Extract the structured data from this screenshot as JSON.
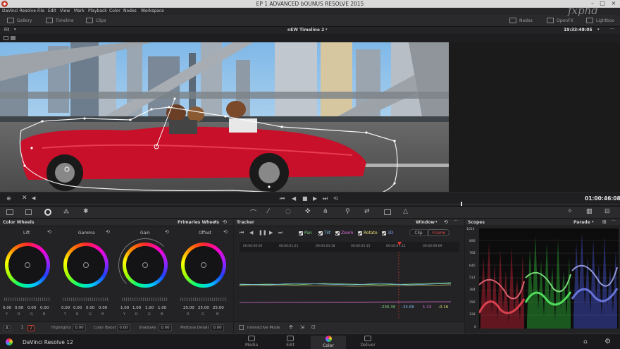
{
  "window": {
    "title": "EP 1 ADVANCED  bOUNUS  RESOLVE 2015",
    "watermark": "fxphd"
  },
  "menu": [
    "DaVinci Resolve",
    "File",
    "Edit",
    "View",
    "Mark",
    "Playback",
    "Color",
    "Nodes",
    "Workspace"
  ],
  "toolbar": {
    "gallery": "Gallery",
    "timeline": "Timeline",
    "clips": "Clips",
    "nodes": "Nodes",
    "openfx": "OpenFX",
    "lightbox": "Lightbox"
  },
  "viewer": {
    "fit": "Fit",
    "timeline_name": "nEW Timeline 2",
    "timecode_top": "19:33:48:05",
    "timecode": "01:00:46:08"
  },
  "color_wheels": {
    "title": "Color Wheels",
    "mode": "Primaries Wheels",
    "wheels": [
      {
        "name": "Lift",
        "values": [
          "0.00",
          "0.00",
          "0.00",
          "0.00"
        ]
      },
      {
        "name": "Gamma",
        "values": [
          "0.00",
          "0.00",
          "0.00",
          "0.00"
        ]
      },
      {
        "name": "Gain",
        "values": [
          "1.00",
          "1.00",
          "1.00",
          "1.00"
        ]
      },
      {
        "name": "Offset",
        "values": [
          "25.00",
          "25.00",
          "25.00",
          ""
        ]
      }
    ],
    "channels": [
      "Y",
      "R",
      "G",
      "B"
    ],
    "page_a": "A",
    "page1": "1",
    "page2": "2",
    "highlights": {
      "label": "Highlights",
      "value": "0.00"
    },
    "color_boost": {
      "label": "Color Boost",
      "value": "0.00"
    },
    "shadows": {
      "label": "Shadows",
      "value": "0.00"
    },
    "midtone": {
      "label": "Midtone Detail",
      "value": "0.00"
    }
  },
  "tracker": {
    "title": "Tracker",
    "mode": "Window",
    "checks": [
      {
        "label": "Pan",
        "color": "#7fd37f"
      },
      {
        "label": "Tilt",
        "color": "#7fc7e8"
      },
      {
        "label": "Zoom",
        "color": "#e070e0"
      },
      {
        "label": "Rotate",
        "color": "#e8e070"
      },
      {
        "label": "3D",
        "color": "#7f9fe8"
      }
    ],
    "clip": "Clip",
    "frame": "Frame",
    "times": [
      "00:00:00:00",
      "00:00:01:21",
      "00:00:03:18",
      "00:00:05:15",
      "00:00:07:12",
      "00:00:09:09"
    ],
    "readouts": [
      {
        "v": "-236.39",
        "color": "#7fd37f"
      },
      {
        "v": "-35.68",
        "color": "#7fb0e8"
      },
      {
        "v": "1.13",
        "color": "#e070e0"
      },
      {
        "v": "-0.16",
        "color": "#e8e070"
      }
    ],
    "interactive": "Interactive Mode"
  },
  "scopes": {
    "title": "Scopes",
    "mode": "Parade",
    "scale": [
      "1023",
      "896",
      "768",
      "640",
      "512",
      "384",
      "256",
      "128",
      "0"
    ]
  },
  "bottom": {
    "app": "DaVinci Resolve 12",
    "pages": [
      "Media",
      "Edit",
      "Color",
      "Deliver"
    ],
    "active": "Color"
  }
}
